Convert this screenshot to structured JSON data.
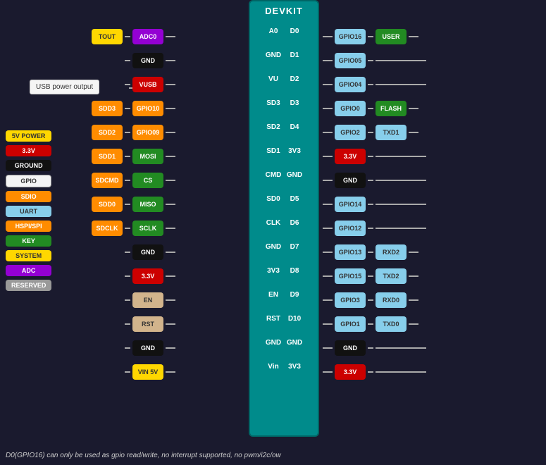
{
  "title": "DEVKIT",
  "usb_label": "USB power output",
  "footer": "D0(GPIO16) can only be used as gpio read/write, no interrupt supported, no pwm/i2c/ow",
  "legend": [
    {
      "label": "5V POWER",
      "bg": "#FFD700",
      "color": "#333"
    },
    {
      "label": "3.3V",
      "bg": "#CC0000",
      "color": "white"
    },
    {
      "label": "GROUND",
      "bg": "#111",
      "color": "white"
    },
    {
      "label": "GPIO",
      "bg": "#f5f5f5",
      "color": "#333"
    },
    {
      "label": "SDIO",
      "bg": "#FF8C00",
      "color": "white"
    },
    {
      "label": "UART",
      "bg": "#87CEEB",
      "color": "#333"
    },
    {
      "label": "HSPI/SPI",
      "bg": "#FF8C00",
      "color": "white"
    },
    {
      "label": "KEY",
      "bg": "#228B22",
      "color": "white"
    },
    {
      "label": "SYSTEM",
      "bg": "#FFD700",
      "color": "#333"
    },
    {
      "label": "ADC",
      "bg": "#9400D3",
      "color": "white"
    },
    {
      "label": "RESERVED",
      "bg": "#999",
      "color": "white"
    }
  ],
  "left_pins": [
    {
      "inner": "ADC0",
      "inner_bg": "#9400D3",
      "inner_color": "white",
      "outer": "TOUT",
      "outer_bg": "#FFD700",
      "outer_color": "#333",
      "board_left": "A0",
      "has_outer": true
    },
    {
      "inner": "GND",
      "inner_bg": "#111",
      "inner_color": "white",
      "board_left": "GND",
      "has_outer": false
    },
    {
      "inner": "VUSB",
      "inner_bg": "#CC0000",
      "inner_color": "white",
      "board_left": "VU",
      "has_outer": false,
      "usb": true
    },
    {
      "inner": "GPIO10",
      "inner_bg": "#FF8C00",
      "inner_color": "white",
      "outer": "SDD3",
      "outer_bg": "#FF8C00",
      "outer_color": "white",
      "board_left": "SD3",
      "has_outer": true
    },
    {
      "inner": "GPIO09",
      "inner_bg": "#FF8C00",
      "inner_color": "white",
      "outer": "SDD2",
      "outer_bg": "#FF8C00",
      "outer_color": "white",
      "board_left": "SD2",
      "has_outer": true
    },
    {
      "inner": "MOSI",
      "inner_bg": "#228B22",
      "inner_color": "white",
      "outer": "SDD1",
      "outer_bg": "#FF8C00",
      "outer_color": "white",
      "board_left": "SD1",
      "has_outer": true
    },
    {
      "inner": "CS",
      "inner_bg": "#228B22",
      "inner_color": "white",
      "outer": "SDCMD",
      "outer_bg": "#FF8C00",
      "outer_color": "white",
      "board_left": "CMD",
      "has_outer": true
    },
    {
      "inner": "MISO",
      "inner_bg": "#228B22",
      "inner_color": "white",
      "outer": "SDD0",
      "outer_bg": "#FF8C00",
      "outer_color": "white",
      "board_left": "SD0",
      "has_outer": true
    },
    {
      "inner": "SCLK",
      "inner_bg": "#228B22",
      "inner_color": "white",
      "outer": "SDCLK",
      "outer_bg": "#FF8C00",
      "outer_color": "white",
      "board_left": "CLK",
      "has_outer": true
    },
    {
      "inner": "GND",
      "inner_bg": "#111",
      "inner_color": "white",
      "board_left": "GND",
      "has_outer": false
    },
    {
      "inner": "3.3V",
      "inner_bg": "#CC0000",
      "inner_color": "white",
      "board_left": "3V3",
      "has_outer": false
    },
    {
      "inner": "EN",
      "inner_bg": "#D2B48C",
      "inner_color": "#333",
      "board_left": "EN",
      "has_outer": false
    },
    {
      "inner": "RST",
      "inner_bg": "#D2B48C",
      "inner_color": "#333",
      "board_left": "RST",
      "has_outer": false
    },
    {
      "inner": "GND",
      "inner_bg": "#111",
      "inner_color": "white",
      "board_left": "GND",
      "has_outer": false
    },
    {
      "inner": "VIN 5V",
      "inner_bg": "#FFD700",
      "inner_color": "#333",
      "board_left": "Vin",
      "has_outer": false
    }
  ],
  "right_pins": [
    {
      "board_right": "D0",
      "inner": "GPIO16",
      "inner_bg": "#87CEEB",
      "inner_color": "#333",
      "outer": "USER",
      "outer_bg": "#228B22",
      "outer_color": "white",
      "has_outer": true
    },
    {
      "board_right": "D1",
      "inner": "GPIO05",
      "inner_bg": "#87CEEB",
      "inner_color": "#333",
      "has_outer": false
    },
    {
      "board_right": "D2",
      "inner": "GPIO04",
      "inner_bg": "#87CEEB",
      "inner_color": "#333",
      "has_outer": false
    },
    {
      "board_right": "D3",
      "inner": "GPIO0",
      "inner_bg": "#87CEEB",
      "inner_color": "#333",
      "outer": "FLASH",
      "outer_bg": "#228B22",
      "outer_color": "white",
      "has_outer": true
    },
    {
      "board_right": "D4",
      "inner": "GPIO2",
      "inner_bg": "#87CEEB",
      "inner_color": "#333",
      "outer": "TXD1",
      "outer_bg": "#87CEEB",
      "outer_color": "#333",
      "has_outer": true
    },
    {
      "board_right": "3V3",
      "inner": "3.3V",
      "inner_bg": "#CC0000",
      "inner_color": "white",
      "has_outer": false
    },
    {
      "board_right": "GND",
      "inner": "GND",
      "inner_bg": "#111",
      "inner_color": "white",
      "has_outer": false
    },
    {
      "board_right": "D5",
      "inner": "GPIO14",
      "inner_bg": "#87CEEB",
      "inner_color": "#333",
      "has_outer": false
    },
    {
      "board_right": "D6",
      "inner": "GPIO12",
      "inner_bg": "#87CEEB",
      "inner_color": "#333",
      "has_outer": false
    },
    {
      "board_right": "D7",
      "inner": "GPIO13",
      "inner_bg": "#87CEEB",
      "inner_color": "#333",
      "outer": "RXD2",
      "outer_bg": "#87CEEB",
      "outer_color": "#333",
      "has_outer": true
    },
    {
      "board_right": "D8",
      "inner": "GPIO15",
      "inner_bg": "#87CEEB",
      "inner_color": "#333",
      "outer": "TXD2",
      "outer_bg": "#87CEEB",
      "outer_color": "#333",
      "has_outer": true
    },
    {
      "board_right": "D9",
      "inner": "GPIO3",
      "inner_bg": "#87CEEB",
      "inner_color": "#333",
      "outer": "RXD0",
      "outer_bg": "#87CEEB",
      "outer_color": "#333",
      "has_outer": true
    },
    {
      "board_right": "D10",
      "inner": "GPIO1",
      "inner_bg": "#87CEEB",
      "inner_color": "#333",
      "outer": "TXD0",
      "outer_bg": "#87CEEB",
      "outer_color": "#333",
      "has_outer": true
    },
    {
      "board_right": "GND",
      "inner": "GND",
      "inner_bg": "#111",
      "inner_color": "white",
      "has_outer": false
    },
    {
      "board_right": "3V3",
      "inner": "3.3V",
      "inner_bg": "#CC0000",
      "inner_color": "white",
      "has_outer": false
    }
  ]
}
